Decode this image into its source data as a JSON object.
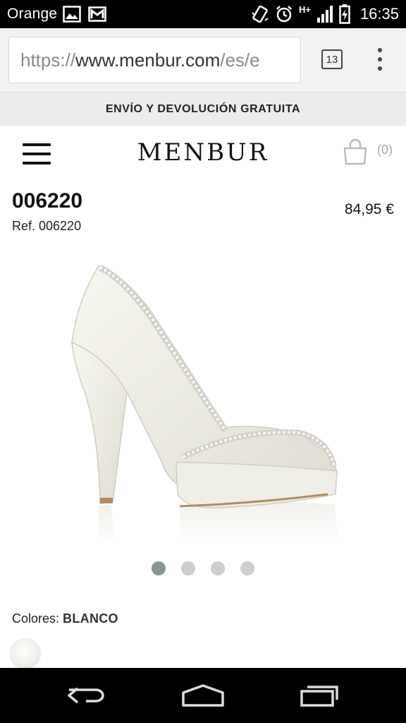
{
  "status_bar": {
    "carrier": "Orange",
    "time": "16:35",
    "network_label": "H+",
    "left_icons": [
      "image-notification-icon",
      "gmail-notification-icon"
    ],
    "right_icons": [
      "vibrate-icon",
      "alarm-icon",
      "network-type-icon",
      "signal-icon",
      "battery-charging-icon"
    ]
  },
  "browser": {
    "url_scheme": "https://",
    "url_host": "www.menbur.com",
    "url_path": "/es/e",
    "tab_count": "13"
  },
  "promo": {
    "text": "ENVÍO Y DEVOLUCIÓN GRATUITA"
  },
  "header": {
    "logo": "MENBUR",
    "cart_count": "(0)"
  },
  "product": {
    "name": "006220",
    "ref": "Ref. 006220",
    "price": "84,95 €",
    "image_alt": "white-peep-toe-platform-pump",
    "carousel_total": 4,
    "carousel_active": 1,
    "colors_label": "Colores:",
    "color_value": "BLANCO"
  },
  "colors": {
    "status_bar_bg": "#000000",
    "promo_bg": "#ececec",
    "dot_active": "#8a9590",
    "dot_inactive": "#c9d0cd"
  }
}
